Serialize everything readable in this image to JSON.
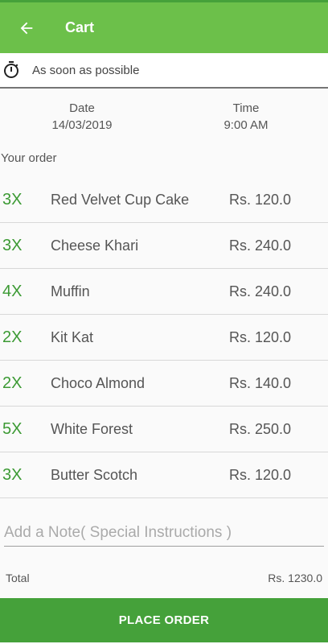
{
  "header": {
    "title": "Cart",
    "back_icon": "arrow-left-icon"
  },
  "delivery": {
    "timer_icon": "stopwatch-icon",
    "text": "As soon as possible"
  },
  "schedule": {
    "date_label": "Date",
    "date_value": "14/03/2019",
    "time_label": "Time",
    "time_value": "9:00 AM"
  },
  "order": {
    "heading": "Your order",
    "items": [
      {
        "qty": "3X",
        "name": "Red Velvet Cup Cake",
        "price": "Rs. 120.0"
      },
      {
        "qty": "3X",
        "name": "Cheese Khari",
        "price": "Rs. 240.0"
      },
      {
        "qty": "4X",
        "name": "Muffin",
        "price": "Rs. 240.0"
      },
      {
        "qty": "2X",
        "name": "Kit Kat",
        "price": "Rs. 120.0"
      },
      {
        "qty": "2X",
        "name": "Choco Almond",
        "price": "Rs. 140.0"
      },
      {
        "qty": "5X",
        "name": "White Forest",
        "price": "Rs. 250.0"
      },
      {
        "qty": "3X",
        "name": "Butter Scotch",
        "price": "Rs. 120.0"
      }
    ]
  },
  "note": {
    "placeholder": "Add a Note( Special Instructions )",
    "value": ""
  },
  "total": {
    "label": "Total",
    "value": "Rs. 1230.0"
  },
  "place_order": {
    "label": "PLACE ORDER"
  },
  "colors": {
    "appbar": "#6cc04a",
    "button": "#45a13a",
    "qty": "#3c9a34"
  }
}
